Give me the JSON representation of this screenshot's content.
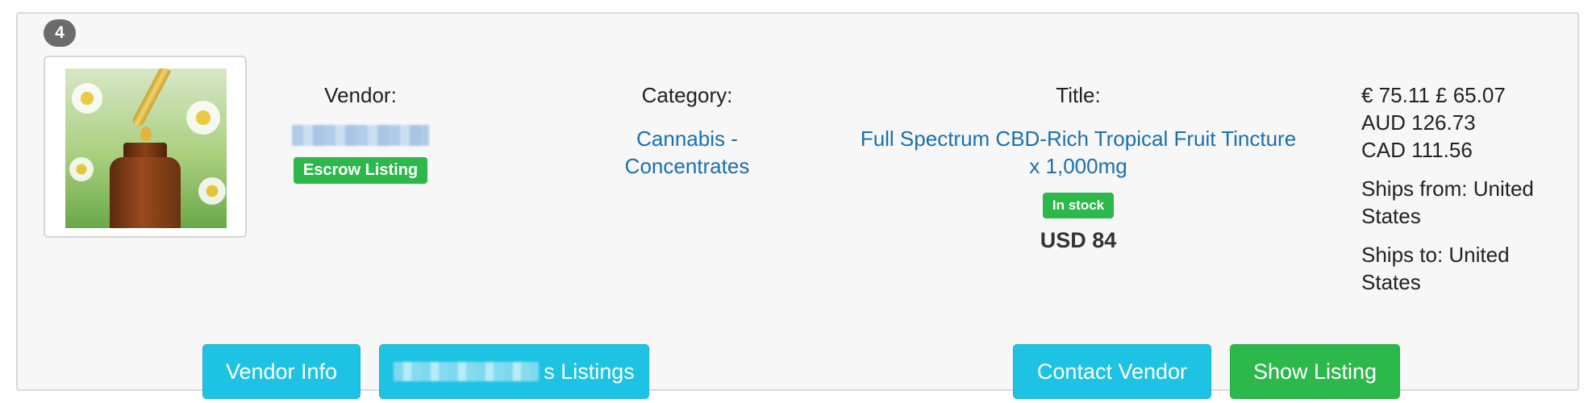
{
  "listing": {
    "index": "4",
    "image_alt": "CBD tincture dropper bottle",
    "vendor_label": "Vendor:",
    "vendor_name_redacted": true,
    "escrow_badge": "Escrow Listing",
    "category_label": "Category:",
    "category_value_line1": "Cannabis -",
    "category_value_line2": "Concentrates",
    "title_label": "Title:",
    "title_line1": "Full Spectrum CBD-Rich Tropical Fruit Tincture",
    "title_line2": "x 1,000mg",
    "stock_badge": "In stock",
    "price_usd": "USD 84",
    "price_eur_gbp": "€ 75.11 £ 65.07",
    "price_aud": "AUD 126.73",
    "price_cad": "CAD 111.56",
    "ships_from_line1": "Ships from: United",
    "ships_from_line2": "States",
    "ships_to_line1": "Ships to: United",
    "ships_to_line2": "States"
  },
  "buttons": {
    "vendor_info": "Vendor Info",
    "vendor_listings_suffix": "s Listings",
    "contact_vendor": "Contact Vendor",
    "show_listing": "Show Listing"
  },
  "colors": {
    "info_button": "#1ec3e3",
    "success": "#2db84b",
    "link": "#1a6fb0",
    "card_bg": "#f7f7f7",
    "index_badge": "#6c6c6c"
  },
  "icons": {
    "listing_image": "cbd-bottle-image"
  }
}
